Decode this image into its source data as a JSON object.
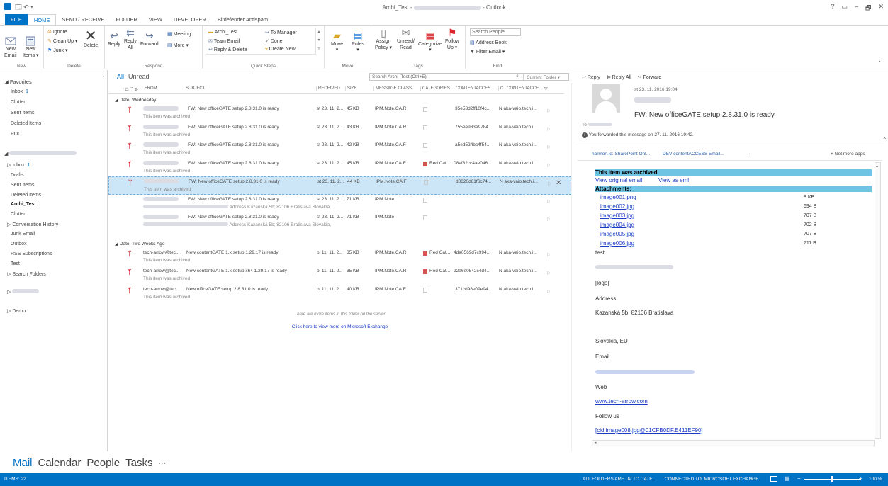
{
  "window": {
    "title": "Archi_Test - ",
    "app": " - Outlook",
    "controls": [
      "?",
      "▭",
      "–",
      "🗗",
      "✕"
    ]
  },
  "tabs": [
    "FILE",
    "HOME",
    "SEND / RECEIVE",
    "FOLDER",
    "VIEW",
    "DEVELOPER",
    "Bitdefender Antispam"
  ],
  "ribbon": {
    "new": {
      "new_email": "New\nEmail",
      "new_items": "New\nItems ▾",
      "label": "New"
    },
    "delete": {
      "ignore": "Ignore",
      "cleanup": "Clean Up ▾",
      "junk": "Junk ▾",
      "delete": "Delete",
      "label": "Delete"
    },
    "respond": {
      "reply": "Reply",
      "reply_all": "Reply\nAll",
      "forward": "Forward",
      "meeting": "Meeting",
      "more": "More ▾",
      "label": "Respond"
    },
    "quicksteps": {
      "items": [
        "Archi_Test",
        "Team Email",
        "Reply & Delete",
        "To Manager",
        "Done",
        "Create New"
      ],
      "label": "Quick Steps"
    },
    "move": {
      "move": "Move",
      "rules": "Rules",
      "label": "Move"
    },
    "tags": {
      "assign": "Assign\nPolicy ▾",
      "unread": "Unread/\nRead",
      "categorize": "Categorize",
      "follow": "Follow\nUp ▾",
      "label": "Tags"
    },
    "find": {
      "search_people": "Search People",
      "address_book": "Address Book",
      "filter": "Filter Email ▾",
      "label": "Find"
    }
  },
  "folders": {
    "favorites": "◢ Favorites",
    "fav_items": [
      {
        "name": "Inbox",
        "count": "1"
      },
      {
        "name": "Clutter",
        "count": ""
      },
      {
        "name": "Sent Items",
        "count": ""
      },
      {
        "name": "Deleted Items",
        "count": ""
      },
      {
        "name": "POC",
        "count": ""
      }
    ],
    "mail_items": [
      {
        "name": "▷ Inbox",
        "count": "1",
        "bold": false
      },
      {
        "name": "Drafts",
        "count": "",
        "bold": false
      },
      {
        "name": "Sent Items",
        "count": "",
        "bold": false
      },
      {
        "name": "Deleted Items",
        "count": "",
        "bold": false
      },
      {
        "name": "Archi_Test",
        "count": "",
        "bold": true
      },
      {
        "name": "Clutter",
        "count": "",
        "bold": false
      },
      {
        "name": "▷ Conversation History",
        "count": "",
        "bold": false
      },
      {
        "name": "Junk Email",
        "count": "",
        "bold": false
      },
      {
        "name": "Outbox",
        "count": "",
        "bold": false
      },
      {
        "name": "RSS Subscriptions",
        "count": "",
        "bold": false
      },
      {
        "name": "Test",
        "count": "",
        "bold": false
      },
      {
        "name": "▷ Search Folders",
        "count": "",
        "bold": false
      }
    ],
    "demo": "▷ Demo"
  },
  "list": {
    "filter_all": "All",
    "filter_unread": "Unread",
    "search_placeholder": "Search Archi_Test (Ctrl+E)",
    "scope": "Current Folder ▾",
    "headers": [
      "! ☖ 🗋 ⊘",
      "FROM",
      "SUBJECT",
      "RECEIVED",
      "SIZE",
      "MESSAGE CLASS",
      "CATEGORIES",
      "CONTENTACCES...",
      "C",
      "CONTENTACCE...",
      "▽"
    ],
    "group1": "◢  Date: Wednesday",
    "group2": "◢  Date: Two Weeks Ago",
    "rows_g1": [
      {
        "subject": "FW: New officeGATE setup 2.8.31.0 is ready",
        "second": "This item was archived",
        "received": "st 23. 11. 2...",
        "size": "45 KB",
        "cls": "IPM.Note.CA.R",
        "cat": "",
        "ca": "35e53d2ff10f4c...",
        "ca2": "N aka-vaio.tech.i...",
        "selected": false,
        "icon": true
      },
      {
        "subject": "FW: New officeGATE setup 2.8.31.0 is ready",
        "second": "This item was archived",
        "received": "st 23. 11. 2...",
        "size": "43 KB",
        "cls": "IPM.Note.CA.R",
        "cat": "",
        "ca": "755ee933e9784...",
        "ca2": "N aka-vaio.tech.i...",
        "selected": false,
        "icon": true
      },
      {
        "subject": "FW: New officeGATE setup 2.8.31.0 is ready",
        "second": "This item was archived",
        "received": "st 23. 11. 2...",
        "size": "42 KB",
        "cls": "IPM.Note.CA.F",
        "cat": "",
        "ca": "a5ed524bc4f54...",
        "ca2": "N aka-vaio.tech.i...",
        "selected": false,
        "icon": true
      },
      {
        "subject": "FW: New officeGATE setup 2.8.31.0 is ready",
        "second": "This item was archived",
        "received": "st 23. 11. 2...",
        "size": "45 KB",
        "cls": "IPM.Note.CA.F",
        "cat": "Red Cat...",
        "ca": "08ef62cc4ae046...",
        "ca2": "N aka-vaio.tech.i...",
        "selected": false,
        "icon": true
      },
      {
        "subject": "FW: New officeGATE setup 2.8.31.0 is ready",
        "second": "This item was archived",
        "received": "st 23. 11. 2...",
        "size": "44 KB",
        "cls": "IPM.Note.CA.F",
        "cat": "",
        "ca": "d0620d61f6c74...",
        "ca2": "N aka-vaio.tech.i...",
        "selected": true,
        "icon": true
      },
      {
        "subject": "FW: New officeGATE setup 2.8.31.0 is ready",
        "second": "Address  Kazanská 5b; 82106 Bratislava  Slovakia,",
        "received": "st 23. 11. 2...",
        "size": "71 KB",
        "cls": "IPM.Note",
        "cat": "",
        "ca": "",
        "ca2": "",
        "selected": false,
        "icon": false
      },
      {
        "subject": "FW: New officeGATE setup 2.8.31.0 is ready",
        "second": "Address  Kazanská 5b; 82106 Bratislava  Slovakia,",
        "received": "st 23. 11. 2...",
        "size": "71 KB",
        "cls": "IPM.Note",
        "cat": "",
        "ca": "",
        "ca2": "",
        "selected": false,
        "icon": false
      }
    ],
    "rows_g2": [
      {
        "from": "tech-arrow@tec...",
        "subject": "New contentGATE 1.x setup 1.29.17 is ready",
        "second": "This item was archived",
        "received": "pi 11. 11. 2...",
        "size": "35 KB",
        "cls": "IPM.Note.CA.R",
        "cat": "Red Cat...",
        "ca": "4da0569d7c994...",
        "ca2": "N aka-vaio.tech.i..."
      },
      {
        "from": "tech-arrow@tec...",
        "subject": "New contentGATE 1.x setup x64 1.29.17 is ready",
        "second": "This item was archived",
        "received": "pi 11. 11. 2...",
        "size": "35 KB",
        "cls": "IPM.Note.CA.R",
        "cat": "Red Cat...",
        "ca": "92a6e0542c4d4...",
        "ca2": "N aka-vaio.tech.i..."
      },
      {
        "from": "tech-arrow@tec...",
        "subject": "New officeGATE setup 2.8.31.0 is ready",
        "second": "This item was archived",
        "received": "pi 11. 11. 2...",
        "size": "40 KB",
        "cls": "IPM.Note.CA.F",
        "cat": "",
        "ca": "371cd98e09e94...",
        "ca2": "N aka-vaio.tech.i..."
      }
    ],
    "more_text": "There are more items in this folder on the server",
    "more_link": "Click here to view more on Microsoft Exchange"
  },
  "reading": {
    "reply": "Reply",
    "reply_all": "Reply All",
    "forward": "Forward",
    "date": "st 23. 11. 2016 19:04",
    "subject": "FW: New officeGATE setup 2.8.31.0 is ready",
    "to": "To",
    "info": "You forwarded this message on 27. 11. 2016 19:42.",
    "addins": [
      "harmon.ie: SharePoint Onl...",
      "DEV contentACCESS Email...",
      "..."
    ],
    "get_more": "+ Get more apps",
    "archived": "This item was archived",
    "view_original": "View original email",
    "view_eml": "View as eml",
    "attachments": "Attachments:",
    "files": [
      {
        "name": "image001.png",
        "size": "8 KB"
      },
      {
        "name": "image002.jpg",
        "size": "694 B"
      },
      {
        "name": "image003.jpg",
        "size": "707 B"
      },
      {
        "name": "image004.jpg",
        "size": "702 B"
      },
      {
        "name": "image005.jpg",
        "size": "707 B"
      },
      {
        "name": "image006.jpg",
        "size": "711 B"
      }
    ],
    "body": {
      "test": "test",
      "logo": "[logo]",
      "address": "Address",
      "street": "Kazanská 5b; 82106 Bratislava",
      "country": "Slovakia, EU",
      "email": "Email",
      "web": "Web",
      "web_url": "www.tech-arrow.com",
      "follow": "Follow us",
      "cid": "[cid:image008.jpg@01CFB0DF.E411EF90]"
    }
  },
  "nav": {
    "items": [
      "Mail",
      "Calendar",
      "People",
      "Tasks",
      "···"
    ]
  },
  "status": {
    "items": "ITEMS: 22",
    "folders": "ALL FOLDERS ARE UP TO DATE.",
    "connected": "CONNECTED TO: MICROSOFT EXCHANGE",
    "zoom": "100 %"
  },
  "colors": {
    "accent": "#0072c6",
    "selected": "#cde6f7",
    "flag": "#d9262e",
    "archived_bar": "#6fc3e3"
  }
}
